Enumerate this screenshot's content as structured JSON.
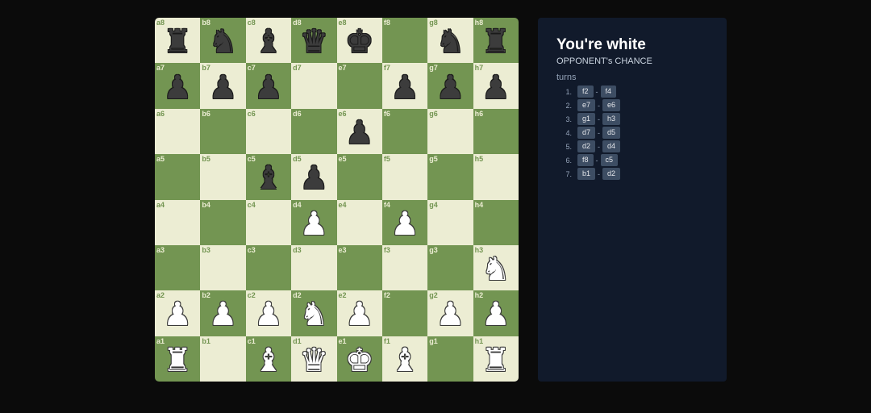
{
  "board": {
    "light_color": "#ecedd3",
    "dark_color": "#739552",
    "files": [
      "a",
      "b",
      "c",
      "d",
      "e",
      "f",
      "g",
      "h"
    ],
    "ranks": [
      "8",
      "7",
      "6",
      "5",
      "4",
      "3",
      "2",
      "1"
    ],
    "pieces": {
      "a8": {
        "color": "black",
        "type": "rook",
        "glyph": "♜"
      },
      "b8": {
        "color": "black",
        "type": "knight",
        "glyph": "♞"
      },
      "c8": {
        "color": "black",
        "type": "bishop",
        "glyph": "♝"
      },
      "d8": {
        "color": "black",
        "type": "queen",
        "glyph": "♛"
      },
      "e8": {
        "color": "black",
        "type": "king",
        "glyph": "♚"
      },
      "g8": {
        "color": "black",
        "type": "knight",
        "glyph": "♞"
      },
      "h8": {
        "color": "black",
        "type": "rook",
        "glyph": "♜"
      },
      "a7": {
        "color": "black",
        "type": "pawn",
        "glyph": "♟"
      },
      "b7": {
        "color": "black",
        "type": "pawn",
        "glyph": "♟"
      },
      "c7": {
        "color": "black",
        "type": "pawn",
        "glyph": "♟"
      },
      "f7": {
        "color": "black",
        "type": "pawn",
        "glyph": "♟"
      },
      "g7": {
        "color": "black",
        "type": "pawn",
        "glyph": "♟"
      },
      "h7": {
        "color": "black",
        "type": "pawn",
        "glyph": "♟"
      },
      "e6": {
        "color": "black",
        "type": "pawn",
        "glyph": "♟"
      },
      "c5": {
        "color": "black",
        "type": "bishop",
        "glyph": "♝"
      },
      "d5": {
        "color": "black",
        "type": "pawn",
        "glyph": "♟"
      },
      "d4": {
        "color": "white",
        "type": "pawn",
        "glyph": "♟"
      },
      "f4": {
        "color": "white",
        "type": "pawn",
        "glyph": "♟"
      },
      "h3": {
        "color": "white",
        "type": "knight",
        "glyph": "♞"
      },
      "a2": {
        "color": "white",
        "type": "pawn",
        "glyph": "♟"
      },
      "b2": {
        "color": "white",
        "type": "pawn",
        "glyph": "♟"
      },
      "c2": {
        "color": "white",
        "type": "pawn",
        "glyph": "♟"
      },
      "d2": {
        "color": "white",
        "type": "knight",
        "glyph": "♞"
      },
      "e2": {
        "color": "white",
        "type": "pawn",
        "glyph": "♟"
      },
      "g2": {
        "color": "white",
        "type": "pawn",
        "glyph": "♟"
      },
      "h2": {
        "color": "white",
        "type": "pawn",
        "glyph": "♟"
      },
      "a1": {
        "color": "white",
        "type": "rook",
        "glyph": "♜"
      },
      "c1": {
        "color": "white",
        "type": "bishop",
        "glyph": "♝"
      },
      "d1": {
        "color": "white",
        "type": "queen",
        "glyph": "♛"
      },
      "e1": {
        "color": "white",
        "type": "king",
        "glyph": "♚"
      },
      "f1": {
        "color": "white",
        "type": "bishop",
        "glyph": "♝"
      },
      "h1": {
        "color": "white",
        "type": "rook",
        "glyph": "♜"
      }
    }
  },
  "panel": {
    "title": "You're white",
    "status": "OPPONENT's CHANCE",
    "turns_label": "turns",
    "turns": [
      {
        "num": "1.",
        "from": "f2",
        "to": "f4"
      },
      {
        "num": "2.",
        "from": "e7",
        "to": "e6"
      },
      {
        "num": "3.",
        "from": "g1",
        "to": "h3"
      },
      {
        "num": "4.",
        "from": "d7",
        "to": "d5"
      },
      {
        "num": "5.",
        "from": "d2",
        "to": "d4"
      },
      {
        "num": "6.",
        "from": "f8",
        "to": "c5"
      },
      {
        "num": "7.",
        "from": "b1",
        "to": "d2"
      }
    ],
    "separator": "-"
  }
}
